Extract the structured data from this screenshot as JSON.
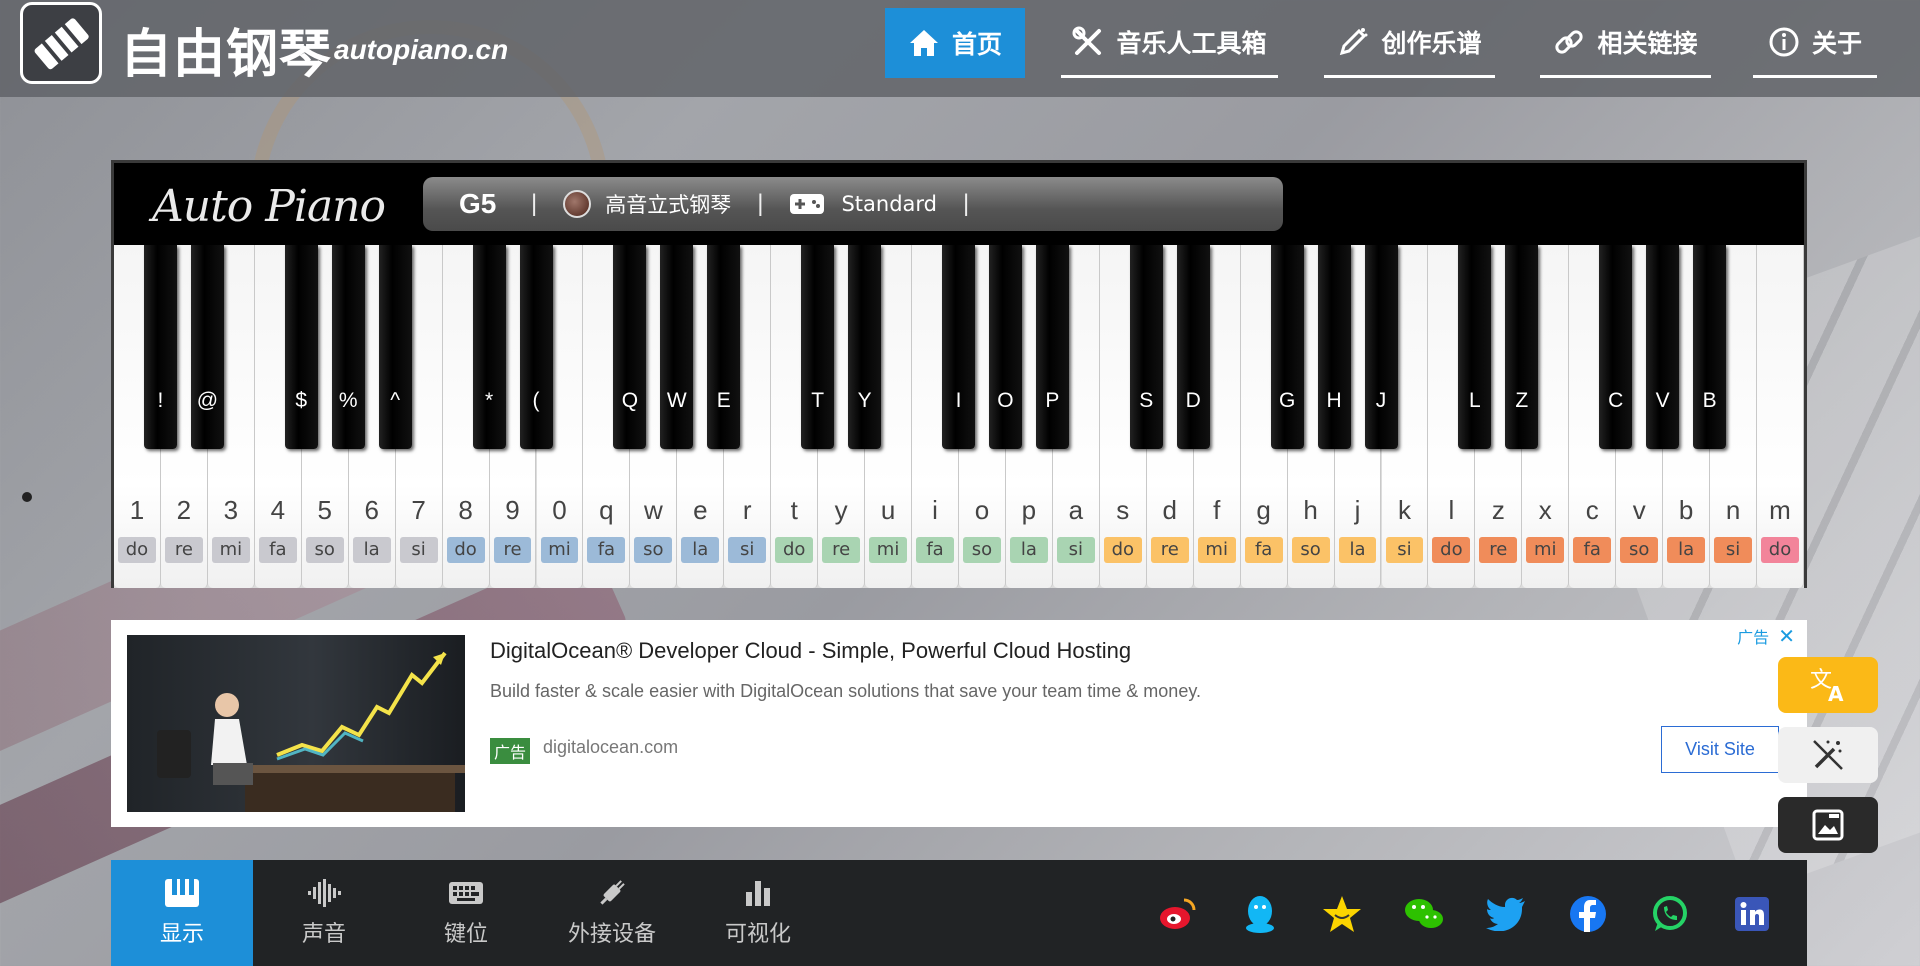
{
  "header": {
    "logo_cn": "自由钢琴",
    "logo_en": "autopiano.cn",
    "nav": [
      {
        "label": "首页",
        "icon": "home-icon",
        "active": true
      },
      {
        "label": "音乐人工具箱",
        "icon": "tools-icon"
      },
      {
        "label": "创作乐谱",
        "icon": "pen-icon"
      },
      {
        "label": "相关链接",
        "icon": "link-icon"
      },
      {
        "label": "关于",
        "icon": "info-icon"
      }
    ]
  },
  "piano": {
    "brand": "Auto Piano",
    "note": "G5",
    "separator": "|",
    "instrument": "高音立式钢琴",
    "mode": "Standard",
    "white_keys": [
      {
        "key": "1",
        "sol": "do",
        "c": "#c9c9cf"
      },
      {
        "key": "2",
        "sol": "re",
        "c": "#c9c9cf"
      },
      {
        "key": "3",
        "sol": "mi",
        "c": "#c9c9cf"
      },
      {
        "key": "4",
        "sol": "fa",
        "c": "#c9c9cf"
      },
      {
        "key": "5",
        "sol": "so",
        "c": "#c9c9cf"
      },
      {
        "key": "6",
        "sol": "la",
        "c": "#c9c9cf"
      },
      {
        "key": "7",
        "sol": "si",
        "c": "#c9c9cf"
      },
      {
        "key": "8",
        "sol": "do",
        "c": "#9cbad8"
      },
      {
        "key": "9",
        "sol": "re",
        "c": "#9cbad8"
      },
      {
        "key": "0",
        "sol": "mi",
        "c": "#9cbad8"
      },
      {
        "key": "q",
        "sol": "fa",
        "c": "#9cbad8"
      },
      {
        "key": "w",
        "sol": "so",
        "c": "#9cbad8"
      },
      {
        "key": "e",
        "sol": "la",
        "c": "#9cbad8"
      },
      {
        "key": "r",
        "sol": "si",
        "c": "#9cbad8"
      },
      {
        "key": "t",
        "sol": "do",
        "c": "#a9d4b2"
      },
      {
        "key": "y",
        "sol": "re",
        "c": "#a9d4b2"
      },
      {
        "key": "u",
        "sol": "mi",
        "c": "#a9d4b2"
      },
      {
        "key": "i",
        "sol": "fa",
        "c": "#a9d4b2"
      },
      {
        "key": "o",
        "sol": "so",
        "c": "#a9d4b2"
      },
      {
        "key": "p",
        "sol": "la",
        "c": "#a9d4b2"
      },
      {
        "key": "a",
        "sol": "si",
        "c": "#a9d4b2"
      },
      {
        "key": "s",
        "sol": "do",
        "c": "#fbc267"
      },
      {
        "key": "d",
        "sol": "re",
        "c": "#fbc267"
      },
      {
        "key": "f",
        "sol": "mi",
        "c": "#fbc267"
      },
      {
        "key": "g",
        "sol": "fa",
        "c": "#fbc267"
      },
      {
        "key": "h",
        "sol": "so",
        "c": "#fbc267"
      },
      {
        "key": "j",
        "sol": "la",
        "c": "#fbc267"
      },
      {
        "key": "k",
        "sol": "si",
        "c": "#fbc267"
      },
      {
        "key": "l",
        "sol": "do",
        "c": "#f08c5a"
      },
      {
        "key": "z",
        "sol": "re",
        "c": "#f08c5a"
      },
      {
        "key": "x",
        "sol": "mi",
        "c": "#f08c5a"
      },
      {
        "key": "c",
        "sol": "fa",
        "c": "#f08c5a"
      },
      {
        "key": "v",
        "sol": "so",
        "c": "#f08c5a"
      },
      {
        "key": "b",
        "sol": "la",
        "c": "#f08c5a"
      },
      {
        "key": "n",
        "sol": "si",
        "c": "#f08c5a"
      },
      {
        "key": "m",
        "sol": "do",
        "c": "#f2849a"
      }
    ],
    "black_keys": [
      {
        "key": "!",
        "after": 0
      },
      {
        "key": "@",
        "after": 1
      },
      {
        "key": "$",
        "after": 3
      },
      {
        "key": "%",
        "after": 4
      },
      {
        "key": "^",
        "after": 5
      },
      {
        "key": "*",
        "after": 7
      },
      {
        "key": "(",
        "after": 8
      },
      {
        "key": "Q",
        "after": 10
      },
      {
        "key": "W",
        "after": 11
      },
      {
        "key": "E",
        "after": 12
      },
      {
        "key": "T",
        "after": 14
      },
      {
        "key": "Y",
        "after": 15
      },
      {
        "key": "I",
        "after": 17
      },
      {
        "key": "O",
        "after": 18
      },
      {
        "key": "P",
        "after": 19
      },
      {
        "key": "S",
        "after": 21
      },
      {
        "key": "D",
        "after": 22
      },
      {
        "key": "G",
        "after": 24
      },
      {
        "key": "H",
        "after": 25
      },
      {
        "key": "J",
        "after": 26
      },
      {
        "key": "L",
        "after": 28
      },
      {
        "key": "Z",
        "after": 29
      },
      {
        "key": "C",
        "after": 31
      },
      {
        "key": "V",
        "after": 32
      },
      {
        "key": "B",
        "after": 33
      }
    ]
  },
  "ad": {
    "title": "DigitalOcean® Developer Cloud - Simple, Powerful Cloud Hosting",
    "description": "Build faster & scale easier with DigitalOcean solutions that save your team time & money.",
    "badge": "广告",
    "domain": "digitalocean.com",
    "cta": "Visit Site",
    "adchoice": "广告"
  },
  "side_buttons": [
    {
      "icon": "translate-icon",
      "color": "#fbb917"
    },
    {
      "icon": "magic-wand-icon",
      "color": "#f0f0f0"
    },
    {
      "icon": "image-frame-icon",
      "color": "#2a2a2a"
    }
  ],
  "bottom_tabs": [
    {
      "label": "显示",
      "icon": "piano-keys-icon",
      "active": true
    },
    {
      "label": "声音",
      "icon": "waveform-icon"
    },
    {
      "label": "键位",
      "icon": "keyboard-icon"
    },
    {
      "label": "外接设备",
      "icon": "plug-icon"
    },
    {
      "label": "可视化",
      "icon": "bar-chart-icon"
    }
  ],
  "social": [
    {
      "icon": "weibo-icon",
      "color": "#e6162d"
    },
    {
      "icon": "qq-icon",
      "color": "#12b7f5"
    },
    {
      "icon": "qzone-icon",
      "color": "#fbd400"
    },
    {
      "icon": "wechat-icon",
      "color": "#2dc100"
    },
    {
      "icon": "twitter-icon",
      "color": "#1da1f2"
    },
    {
      "icon": "facebook-icon",
      "color": "#1877f2"
    },
    {
      "icon": "whatsapp-icon",
      "color": "#25d366"
    },
    {
      "icon": "linkedin-icon",
      "color": "#0a66c2"
    }
  ]
}
